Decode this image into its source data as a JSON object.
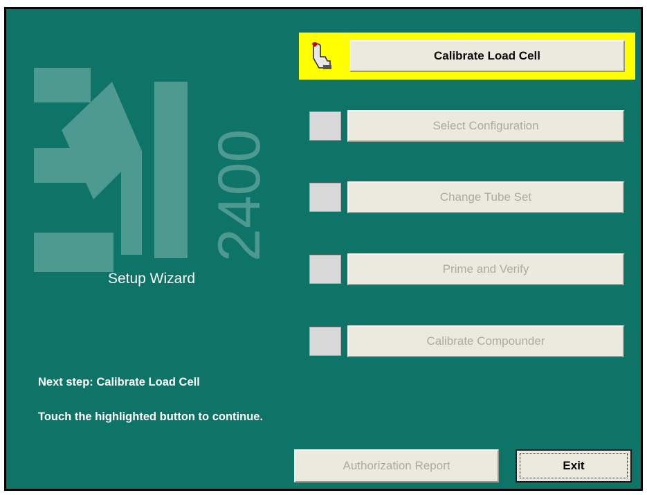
{
  "logo": {
    "mark_text": "2400"
  },
  "wizard": {
    "title": "Setup Wizard"
  },
  "steps": [
    {
      "label": "Calibrate Load Cell",
      "active": true
    },
    {
      "label": "Select Configuration",
      "active": false
    },
    {
      "label": "Change Tube Set",
      "active": false
    },
    {
      "label": "Prime and Verify",
      "active": false
    },
    {
      "label": "Calibrate Compounder",
      "active": false
    }
  ],
  "status": {
    "next_step": "Next step: Calibrate Load Cell",
    "instruction": "Touch the highlighted button to continue."
  },
  "footer": {
    "report_label": "Authorization Report",
    "exit_label": "Exit"
  },
  "colors": {
    "background": "#0e7468",
    "highlight": "#ffff00",
    "button_face": "#ece9df",
    "disabled_text": "#acaaa2",
    "logo_tint": "#4e9990"
  },
  "icons": {
    "active_step_indicator": "pointing-hand-icon"
  }
}
